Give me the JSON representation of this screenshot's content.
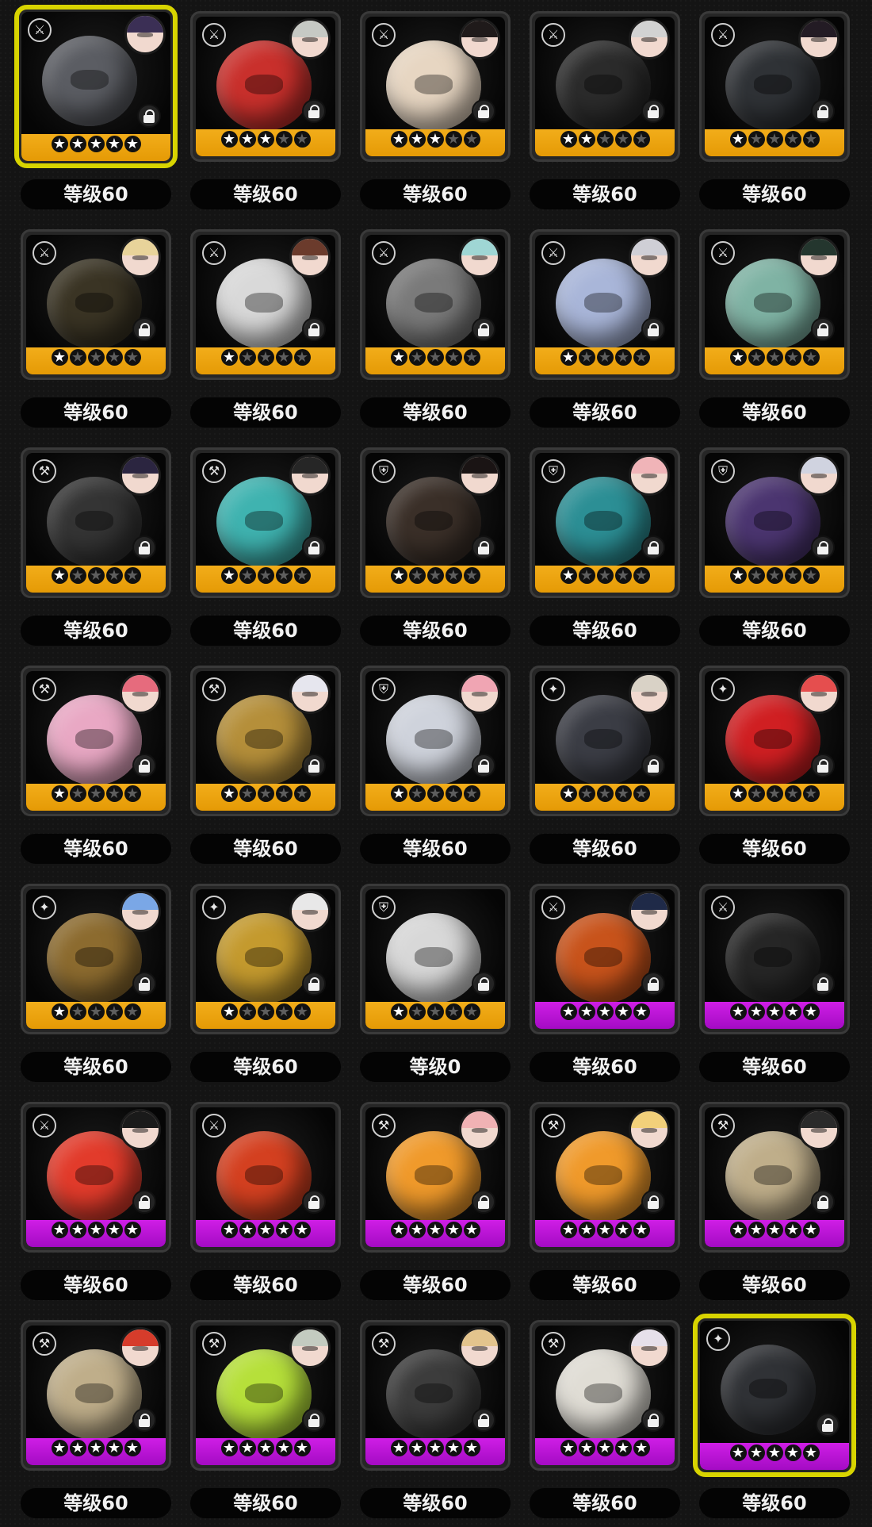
{
  "colors": {
    "rank_a_bar": "#eea411",
    "rank_s_bar": "#c318dc",
    "selected_border": "#d8d400",
    "card_frame": "#3a3a3a",
    "level_pill_bg": "#040404"
  },
  "cards": [
    {
      "level": "等级60",
      "rank": "A",
      "stars": 5,
      "selected": true,
      "type_icon": "crossed-swords-icon",
      "item_color": "#5b5d63",
      "avatar_color": "#3b2f55"
    },
    {
      "level": "等级60",
      "rank": "A",
      "stars": 3,
      "selected": false,
      "type_icon": "crossed-swords-icon",
      "item_color": "#c9302c",
      "avatar_color": "#c6c9c4"
    },
    {
      "level": "等级60",
      "rank": "A",
      "stars": 3,
      "selected": false,
      "type_icon": "crossed-swords-icon",
      "item_color": "#e7d6c2",
      "avatar_color": "#1f1a1a"
    },
    {
      "level": "等级60",
      "rank": "A",
      "stars": 2,
      "selected": false,
      "type_icon": "crossed-swords-icon",
      "item_color": "#2b2b2b",
      "avatar_color": "#d2d2d2"
    },
    {
      "level": "等级60",
      "rank": "A",
      "stars": 1,
      "selected": false,
      "type_icon": "crossed-swords-icon",
      "item_color": "#2f3236",
      "avatar_color": "#231b24"
    },
    {
      "level": "等级60",
      "rank": "A",
      "stars": 1,
      "selected": false,
      "type_icon": "crossed-swords-icon",
      "item_color": "#3a3424",
      "avatar_color": "#e8d39a"
    },
    {
      "level": "等级60",
      "rank": "A",
      "stars": 1,
      "selected": false,
      "type_icon": "crossed-swords-icon",
      "item_color": "#d9d9d9",
      "avatar_color": "#6b3b2c"
    },
    {
      "level": "等级60",
      "rank": "A",
      "stars": 1,
      "selected": false,
      "type_icon": "crossed-swords-icon",
      "item_color": "#7a7a7a",
      "avatar_color": "#9fd6d4"
    },
    {
      "level": "等级60",
      "rank": "A",
      "stars": 1,
      "selected": false,
      "type_icon": "crossed-swords-icon",
      "item_color": "#a9b6d9",
      "avatar_color": "#cfcfd6"
    },
    {
      "level": "等级60",
      "rank": "A",
      "stars": 1,
      "selected": false,
      "type_icon": "crossed-swords-icon",
      "item_color": "#7fb3a4",
      "avatar_color": "#24362e"
    },
    {
      "level": "等级60",
      "rank": "A",
      "stars": 1,
      "selected": false,
      "type_icon": "hammer-icon",
      "item_color": "#343434",
      "avatar_color": "#2b2540"
    },
    {
      "level": "等级60",
      "rank": "A",
      "stars": 1,
      "selected": false,
      "type_icon": "hammer-icon",
      "item_color": "#3fb3b0",
      "avatar_color": "#262626"
    },
    {
      "level": "等级60",
      "rank": "A",
      "stars": 1,
      "selected": false,
      "type_icon": "shield-icon",
      "item_color": "#3a2f28",
      "avatar_color": "#1a1414"
    },
    {
      "level": "等级60",
      "rank": "A",
      "stars": 1,
      "selected": false,
      "type_icon": "shield-icon",
      "item_color": "#2c8f95",
      "avatar_color": "#f0b4b8"
    },
    {
      "level": "等级60",
      "rank": "A",
      "stars": 1,
      "selected": false,
      "type_icon": "shield-icon",
      "item_color": "#4b3570",
      "avatar_color": "#d0d3e0"
    },
    {
      "level": "等级60",
      "rank": "A",
      "stars": 1,
      "selected": false,
      "type_icon": "hammer-icon",
      "item_color": "#e9a8c4",
      "avatar_color": "#e66b7d"
    },
    {
      "level": "等级60",
      "rank": "A",
      "stars": 1,
      "selected": false,
      "type_icon": "hammer-icon",
      "item_color": "#b58f3a",
      "avatar_color": "#e6e6ee"
    },
    {
      "level": "等级60",
      "rank": "A",
      "stars": 1,
      "selected": false,
      "type_icon": "shield-icon",
      "item_color": "#cfd3dc",
      "avatar_color": "#f0a5b3"
    },
    {
      "level": "等级60",
      "rank": "A",
      "stars": 1,
      "selected": false,
      "type_icon": "support-icon",
      "item_color": "#3b3d45",
      "avatar_color": "#d9d2c6"
    },
    {
      "level": "等级60",
      "rank": "A",
      "stars": 1,
      "selected": false,
      "type_icon": "support-icon",
      "item_color": "#d01f22",
      "avatar_color": "#e54e4e"
    },
    {
      "level": "等级60",
      "rank": "A",
      "stars": 1,
      "selected": false,
      "type_icon": "support-icon",
      "item_color": "#8c6b2f",
      "avatar_color": "#7aa7e6"
    },
    {
      "level": "等级60",
      "rank": "A",
      "stars": 1,
      "selected": false,
      "type_icon": "support-icon",
      "item_color": "#c49a2e",
      "avatar_color": "#e8e8e8"
    },
    {
      "level": "等级0",
      "rank": "A",
      "stars": 1,
      "selected": false,
      "type_icon": "shield-icon",
      "item_color": "#d8d8d8",
      "avatar_color": ""
    },
    {
      "level": "等级60",
      "rank": "S",
      "stars": 5,
      "selected": false,
      "type_icon": "crossed-swords-icon",
      "item_color": "#c8531b",
      "avatar_color": "#1f2a48"
    },
    {
      "level": "等级60",
      "rank": "S",
      "stars": 5,
      "selected": false,
      "type_icon": "crossed-swords-icon",
      "item_color": "#262626",
      "avatar_color": ""
    },
    {
      "level": "等级60",
      "rank": "S",
      "stars": 5,
      "selected": false,
      "type_icon": "crossed-swords-icon",
      "item_color": "#e23b2b",
      "avatar_color": "#1a1a1a"
    },
    {
      "level": "等级60",
      "rank": "S",
      "stars": 5,
      "selected": false,
      "type_icon": "crossed-swords-icon",
      "item_color": "#d44020",
      "avatar_color": ""
    },
    {
      "level": "等级60",
      "rank": "S",
      "stars": 5,
      "selected": false,
      "type_icon": "hammer-icon",
      "item_color": "#f09a2b",
      "avatar_color": "#f0b2b4"
    },
    {
      "level": "等级60",
      "rank": "S",
      "stars": 5,
      "selected": false,
      "type_icon": "hammer-icon",
      "item_color": "#f09a2b",
      "avatar_color": "#f2d07a"
    },
    {
      "level": "等级60",
      "rank": "S",
      "stars": 5,
      "selected": false,
      "type_icon": "hammer-icon",
      "item_color": "#bfae8a",
      "avatar_color": "#2a2a2a"
    },
    {
      "level": "等级60",
      "rank": "S",
      "stars": 5,
      "selected": false,
      "type_icon": "hammer-icon",
      "item_color": "#bfae8a",
      "avatar_color": "#d63c2b"
    },
    {
      "level": "等级60",
      "rank": "S",
      "stars": 5,
      "selected": false,
      "type_icon": "hammer-icon",
      "item_color": "#b6e03a",
      "avatar_color": "#c3cbc0"
    },
    {
      "level": "等级60",
      "rank": "S",
      "stars": 5,
      "selected": false,
      "type_icon": "hammer-icon",
      "item_color": "#3c3c3c",
      "avatar_color": "#e3c48d"
    },
    {
      "level": "等级60",
      "rank": "S",
      "stars": 5,
      "selected": false,
      "type_icon": "hammer-icon",
      "item_color": "#e0ddd5",
      "avatar_color": "#e6e0ea"
    },
    {
      "level": "等级60",
      "rank": "S",
      "stars": 5,
      "selected": true,
      "type_icon": "support-icon",
      "item_color": "#303236",
      "avatar_color": ""
    }
  ]
}
